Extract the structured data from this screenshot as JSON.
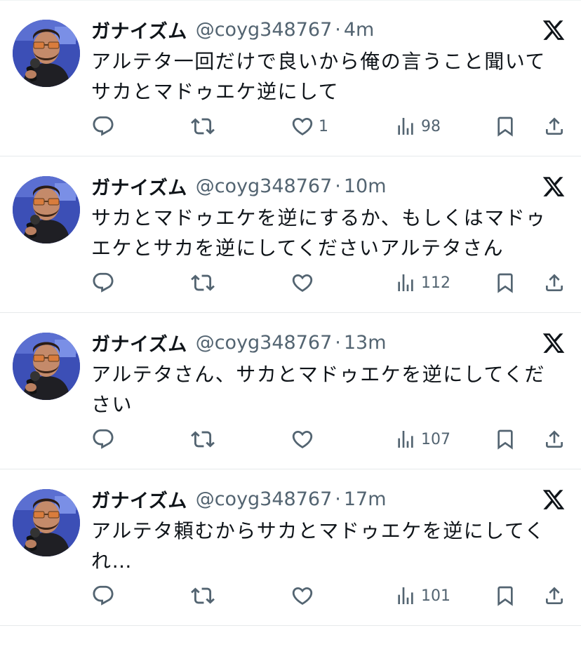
{
  "feed": {
    "tweets": [
      {
        "name": "ガナイズム",
        "handle": "@coyg348767",
        "separator": "·",
        "time": "4m",
        "text": "アルテタ一回だけで良いから俺の言うこと聞いてサカとマドゥエケ逆にして",
        "likes": "1",
        "views": "98"
      },
      {
        "name": "ガナイズム",
        "handle": "@coyg348767",
        "separator": "·",
        "time": "10m",
        "text": "サカとマドゥエケを逆にするか、もしくはマドゥエケとサカを逆にしてくださいアルテタさん",
        "likes": "",
        "views": "112"
      },
      {
        "name": "ガナイズム",
        "handle": "@coyg348767",
        "separator": "·",
        "time": "13m",
        "text": "アルテタさん、サカとマドゥエケを逆にしてください",
        "likes": "",
        "views": "107"
      },
      {
        "name": "ガナイズム",
        "handle": "@coyg348767",
        "separator": "·",
        "time": "17m",
        "text": "アルテタ頼むからサカとマドゥエケを逆にしてくれ…",
        "likes": "",
        "views": "101"
      }
    ]
  },
  "icons": {
    "reply": "reply-icon",
    "retweet": "retweet-icon",
    "like": "heart-icon",
    "views": "views-icon",
    "bookmark": "bookmark-icon",
    "share": "share-icon",
    "platform": "x-logo-icon"
  },
  "colors": {
    "text": "#0f1419",
    "secondary": "#536471",
    "divider": "#e6e9eb",
    "avatar_bg": "#3a4fb8"
  }
}
